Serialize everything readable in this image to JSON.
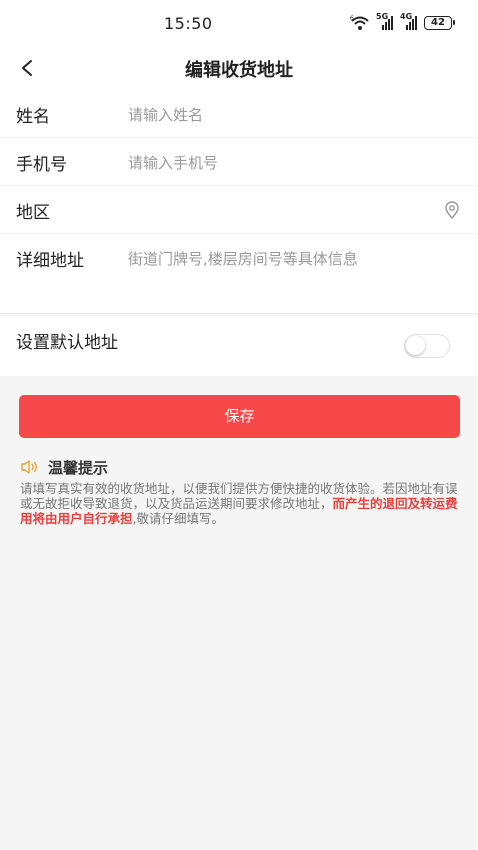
{
  "status_bar": {
    "time": "15:50",
    "signal1_label": "5G",
    "signal2_label": "4G",
    "battery": "42"
  },
  "nav": {
    "title": "编辑收货地址",
    "back_icon": "chevron-left-icon"
  },
  "form": {
    "name": {
      "label": "姓名",
      "placeholder": "请输入姓名"
    },
    "phone": {
      "label": "手机号",
      "placeholder": "请输入手机号"
    },
    "region": {
      "label": "地区",
      "icon": "location-pin-icon"
    },
    "detail": {
      "label": "详细地址",
      "placeholder": "街道门牌号,楼层房间号等具体信息"
    }
  },
  "default_address": {
    "label": "设置默认地址",
    "enabled": false
  },
  "save_button": {
    "label": "保存"
  },
  "tips": {
    "icon": "speaker-icon",
    "title": "温馨提示",
    "text_before": "请填写真实有效的收货地址，以便我们提供方便快捷的收货体验。若因地址有误或无故拒收导致退货，以及货品运送期间要求修改地址，",
    "text_highlight": "而产生的退回及转运费用将由用户自行承担",
    "text_after": ",敬请仔细填写。"
  },
  "colors": {
    "accent": "#f7484a",
    "highlight_text": "#e8403c",
    "tip_icon": "#f0a030"
  }
}
